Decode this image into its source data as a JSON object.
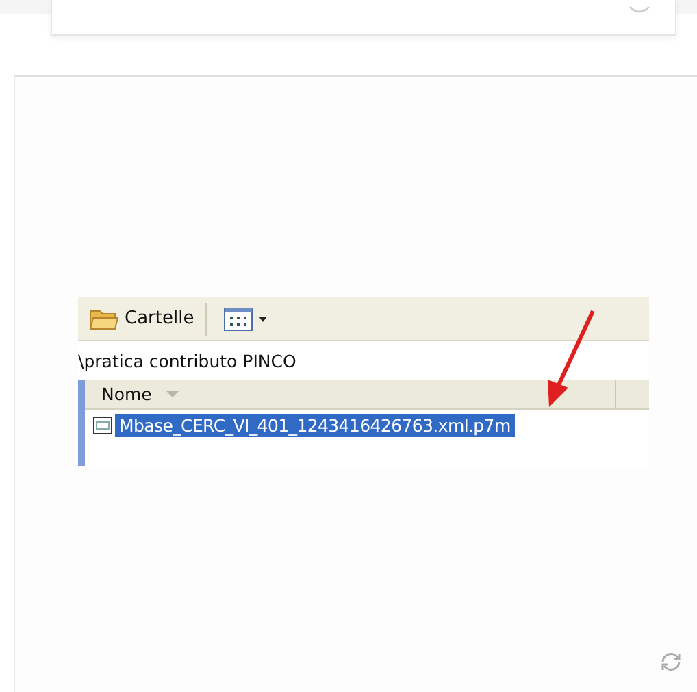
{
  "explorer": {
    "toolbar": [
      {
        "kind": "folders",
        "label": "Cartelle"
      },
      {
        "kind": "views"
      }
    ],
    "address": "\\pratica contributo PINCO",
    "columns": [
      {
        "label": "Nome"
      }
    ],
    "files": [
      {
        "name": "Mbase_CERC_VI_401_1243416426763.xml.p7m",
        "selected": true
      }
    ]
  }
}
